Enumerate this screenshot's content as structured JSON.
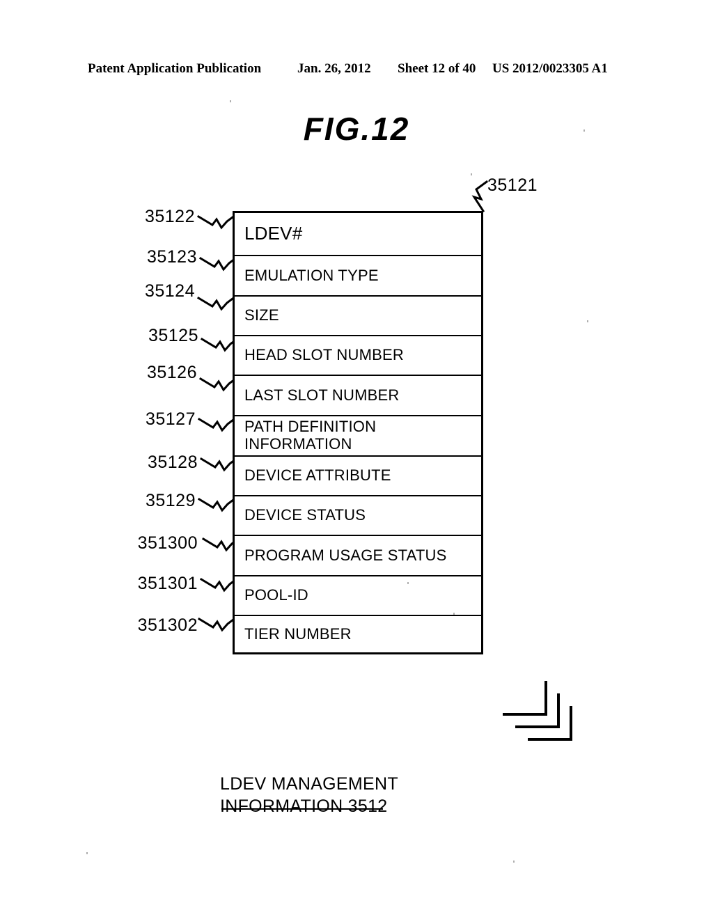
{
  "header": {
    "publication": "Patent Application Publication",
    "date": "Jan. 26, 2012",
    "sheet": "Sheet 12 of 40",
    "patent_number": "US 2012/0023305 A1"
  },
  "figure": {
    "title": "FIG.12",
    "table_reference": "35121",
    "caption": "LDEV MANAGEMENT\nINFORMATION 3512"
  },
  "table": {
    "rows": [
      {
        "ref": "35122",
        "label": "LDEV#"
      },
      {
        "ref": "35123",
        "label": "EMULATION TYPE"
      },
      {
        "ref": "35124",
        "label": "SIZE"
      },
      {
        "ref": "35125",
        "label": "HEAD SLOT NUMBER"
      },
      {
        "ref": "35126",
        "label": "LAST SLOT NUMBER"
      },
      {
        "ref": "35127",
        "label": "PATH DEFINITION\nINFORMATION"
      },
      {
        "ref": "35128",
        "label": "DEVICE ATTRIBUTE"
      },
      {
        "ref": "35129",
        "label": "DEVICE STATUS"
      },
      {
        "ref": "351300",
        "label": "PROGRAM USAGE STATUS"
      },
      {
        "ref": "351301",
        "label": "POOL-ID"
      },
      {
        "ref": "351302",
        "label": "TIER NUMBER"
      }
    ]
  },
  "colors": {
    "ink": "#000000",
    "paper": "#ffffff"
  }
}
